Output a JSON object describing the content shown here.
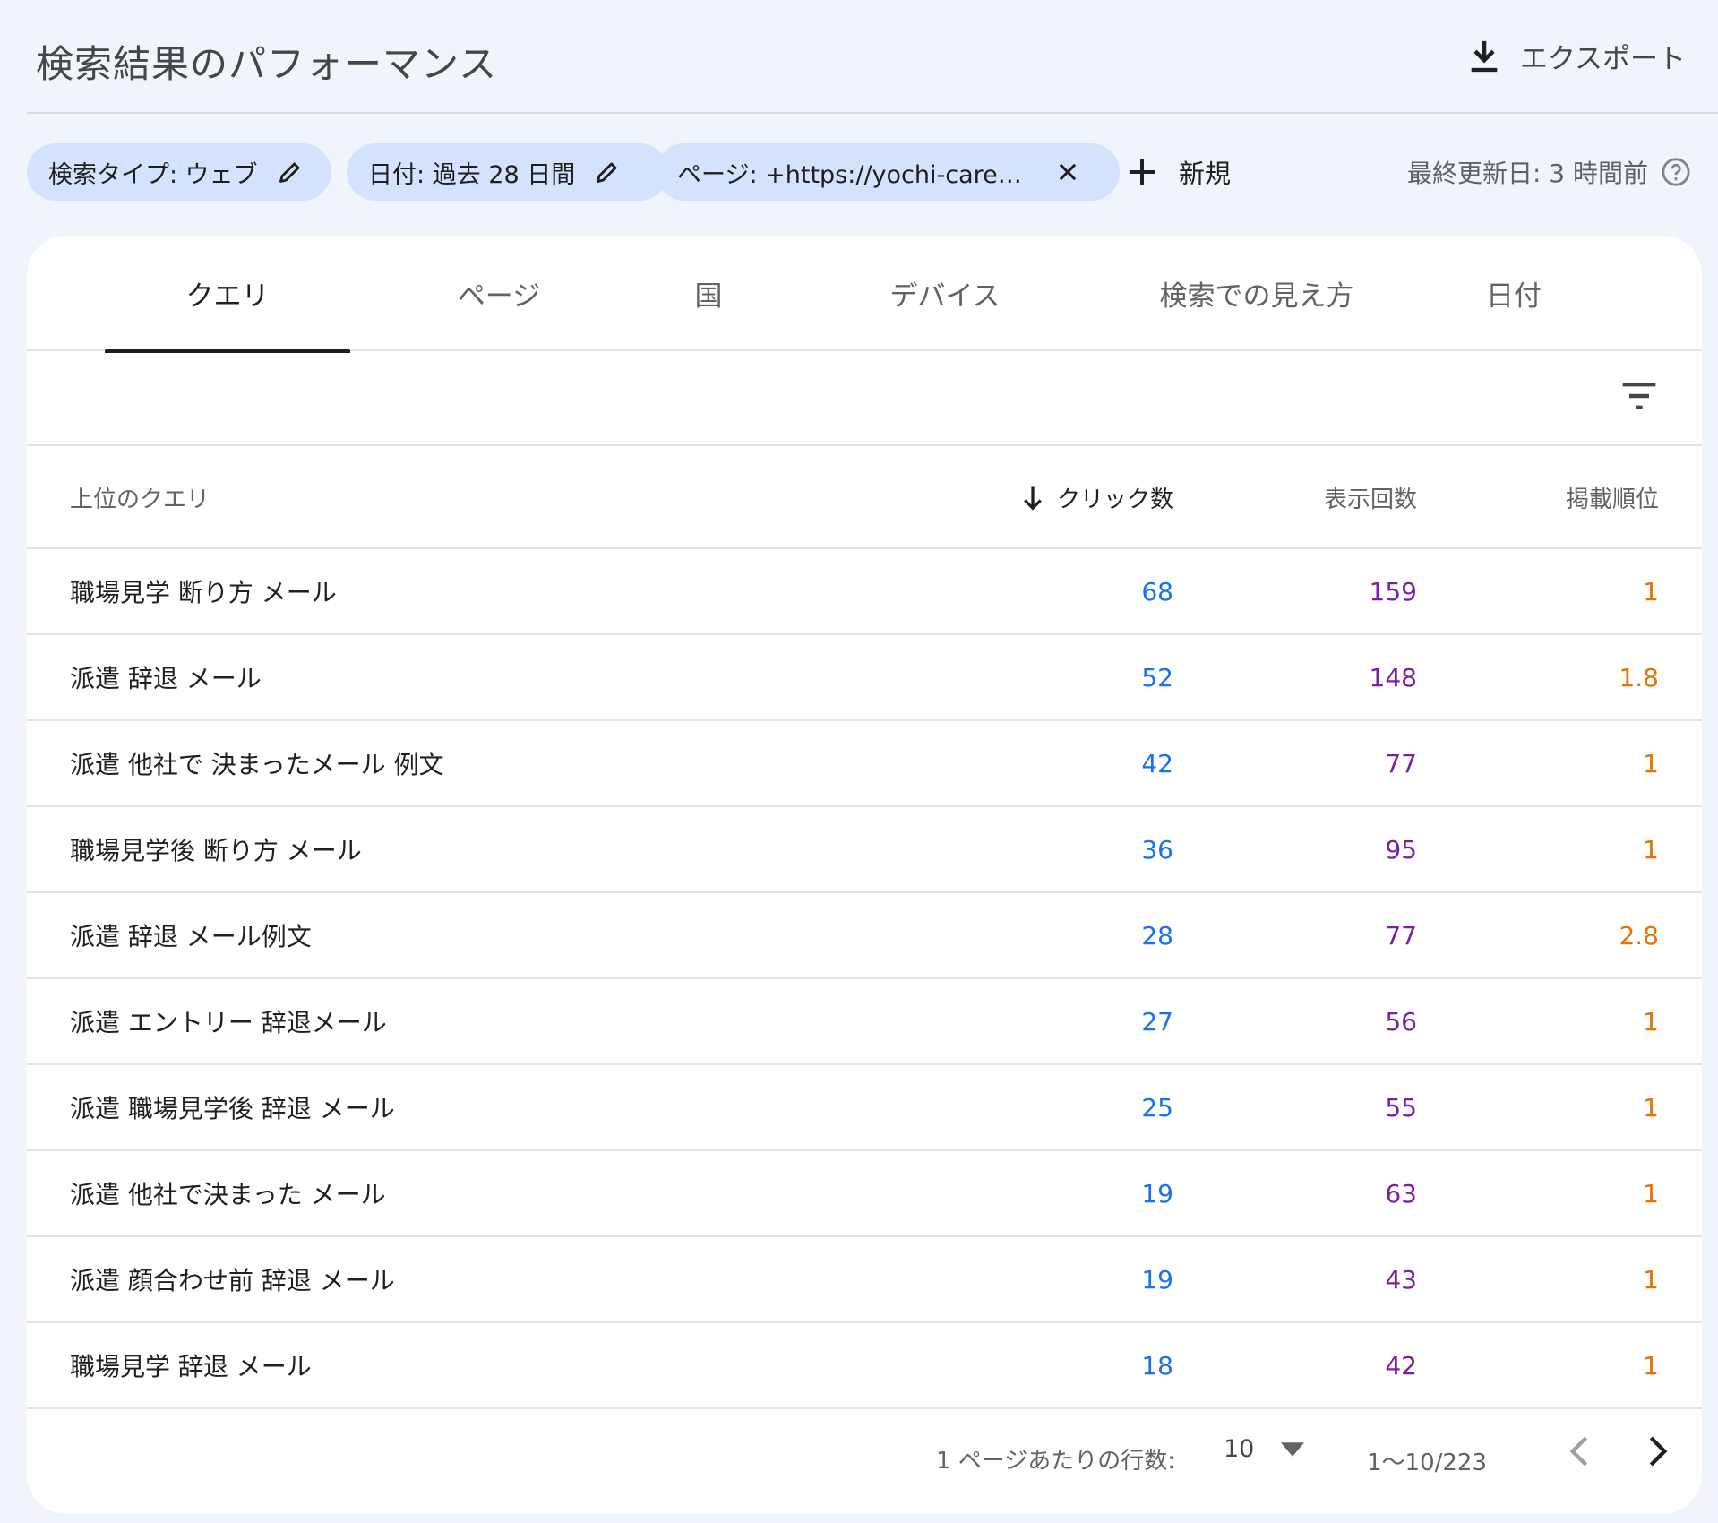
{
  "header": {
    "title": "検索結果のパフォーマンス",
    "export_label": "エクスポート"
  },
  "filters": {
    "search_type": "検索タイプ: ウェブ",
    "date": "日付: 過去 28 日間",
    "page": "ページ: +https://yochi-care…",
    "new_label": "新規",
    "updated": "最終更新日: 3 時間前"
  },
  "tabs": [
    "クエリ",
    "ページ",
    "国",
    "デバイス",
    "検索での見え方",
    "日付"
  ],
  "active_tab": "クエリ",
  "table": {
    "headers": {
      "query": "上位のクエリ",
      "clicks": "クリック数",
      "impressions": "表示回数",
      "position": "掲載順位"
    },
    "rows": [
      {
        "query": "職場見学 断り方 メール",
        "clicks": "68",
        "impressions": "159",
        "position": "1"
      },
      {
        "query": "派遣 辞退 メール",
        "clicks": "52",
        "impressions": "148",
        "position": "1.8"
      },
      {
        "query": "派遣 他社で 決まったメール 例文",
        "clicks": "42",
        "impressions": "77",
        "position": "1"
      },
      {
        "query": "職場見学後 断り方 メール",
        "clicks": "36",
        "impressions": "95",
        "position": "1"
      },
      {
        "query": "派遣 辞退 メール例文",
        "clicks": "28",
        "impressions": "77",
        "position": "2.8"
      },
      {
        "query": "派遣 エントリー 辞退メール",
        "clicks": "27",
        "impressions": "56",
        "position": "1"
      },
      {
        "query": "派遣 職場見学後 辞退 メール",
        "clicks": "25",
        "impressions": "55",
        "position": "1"
      },
      {
        "query": "派遣 他社で決まった メール",
        "clicks": "19",
        "impressions": "63",
        "position": "1"
      },
      {
        "query": "派遣 顔合わせ前 辞退 メール",
        "clicks": "19",
        "impressions": "43",
        "position": "1"
      },
      {
        "query": "職場見学 辞退 メール",
        "clicks": "18",
        "impressions": "42",
        "position": "1"
      }
    ]
  },
  "pagination": {
    "rows_per_page_label": "1 ページあたりの行数:",
    "rows_per_page": "10",
    "range": "1〜10/223"
  },
  "colors": {
    "clicks": "#1a73e8",
    "impressions": "#7b1fa2",
    "position": "#e37400",
    "chip_bg": "#d3e3fd",
    "page_bg": "#f0f4fb"
  }
}
